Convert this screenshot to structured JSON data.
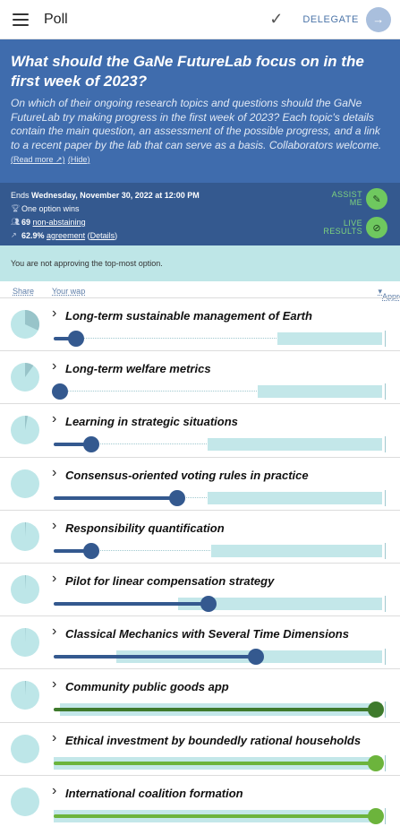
{
  "topbar": {
    "title": "Poll",
    "delegate_label": "DELEGATE",
    "check_icon": "check-icon",
    "delegate_icon": "delegate-arrow-icon"
  },
  "header": {
    "question": "What should the GaNe FutureLab focus on in the first week of 2023?",
    "description": "On which of their ongoing research topics and questions should the GaNe FutureLab try making progress in the first week of 2023? Each topic's details contain the main question, an assessment of the possible progress, and a link to a recent paper by the lab that can serve as a basis. Collaborators welcome.",
    "read_more": "Read more",
    "hide": "Hide"
  },
  "info": {
    "ends_prefix": "Ends",
    "ends_date": "Wednesday, November 30, 2022 at 12:00 PM",
    "option_wins": "One option wins",
    "non_abstaining_count": "69",
    "non_abstaining_label": "non-abstaining",
    "agreement_value": "62.9%",
    "agreement_label": "agreement",
    "details": "Details",
    "assist_me_line1": "ASSIST",
    "assist_me_line2": "ME",
    "live_results_line1": "LIVE",
    "live_results_line2": "RESULTS"
  },
  "notice": "You are not approving the top-most option.",
  "columns": {
    "share": "Share",
    "your_wap": "Your wap",
    "approval": "Approval"
  },
  "colors": {
    "blue": "#34598f",
    "green": "#6cb43c",
    "dark_green": "#3f7a2c",
    "teal_light": "#c3e7e9",
    "pie_bg": "#bde6e8",
    "pie_slice": "#98c4c9"
  },
  "options": [
    {
      "title": "Long-term sustainable management of Earth",
      "share": 0.32,
      "wap": 0.05,
      "approval": 0.32,
      "color": "blue"
    },
    {
      "title": "Long-term welfare metrics",
      "share": 0.1,
      "wap": 0.0,
      "approval": 0.38,
      "color": "blue"
    },
    {
      "title": "Learning in strategic situations",
      "share": 0.03,
      "wap": 0.1,
      "approval": 0.53,
      "color": "blue"
    },
    {
      "title": "Consensus-oriented voting rules in practice",
      "share": 0.0,
      "wap": 0.37,
      "approval": 0.53,
      "color": "blue"
    },
    {
      "title": "Responsibility quantification",
      "share": 0.01,
      "wap": 0.1,
      "approval": 0.52,
      "color": "blue"
    },
    {
      "title": "Pilot for linear compensation strategy",
      "share": 0.01,
      "wap": 0.47,
      "approval": 0.62,
      "color": "blue"
    },
    {
      "title": "Classical Mechanics with Several Time Dimensions",
      "share": 0.005,
      "wap": 0.62,
      "approval": 0.81,
      "color": "blue"
    },
    {
      "title": "Community public goods app",
      "share": 0.01,
      "wap": 1.0,
      "approval": 0.98,
      "color": "dark_green"
    },
    {
      "title": "Ethical investment by boundedly rational households",
      "share": 0.0,
      "wap": 1.0,
      "approval": 1.0,
      "color": "green"
    },
    {
      "title": "International coalition formation",
      "share": 0.0,
      "wap": 1.0,
      "approval": 1.0,
      "color": "green"
    }
  ]
}
